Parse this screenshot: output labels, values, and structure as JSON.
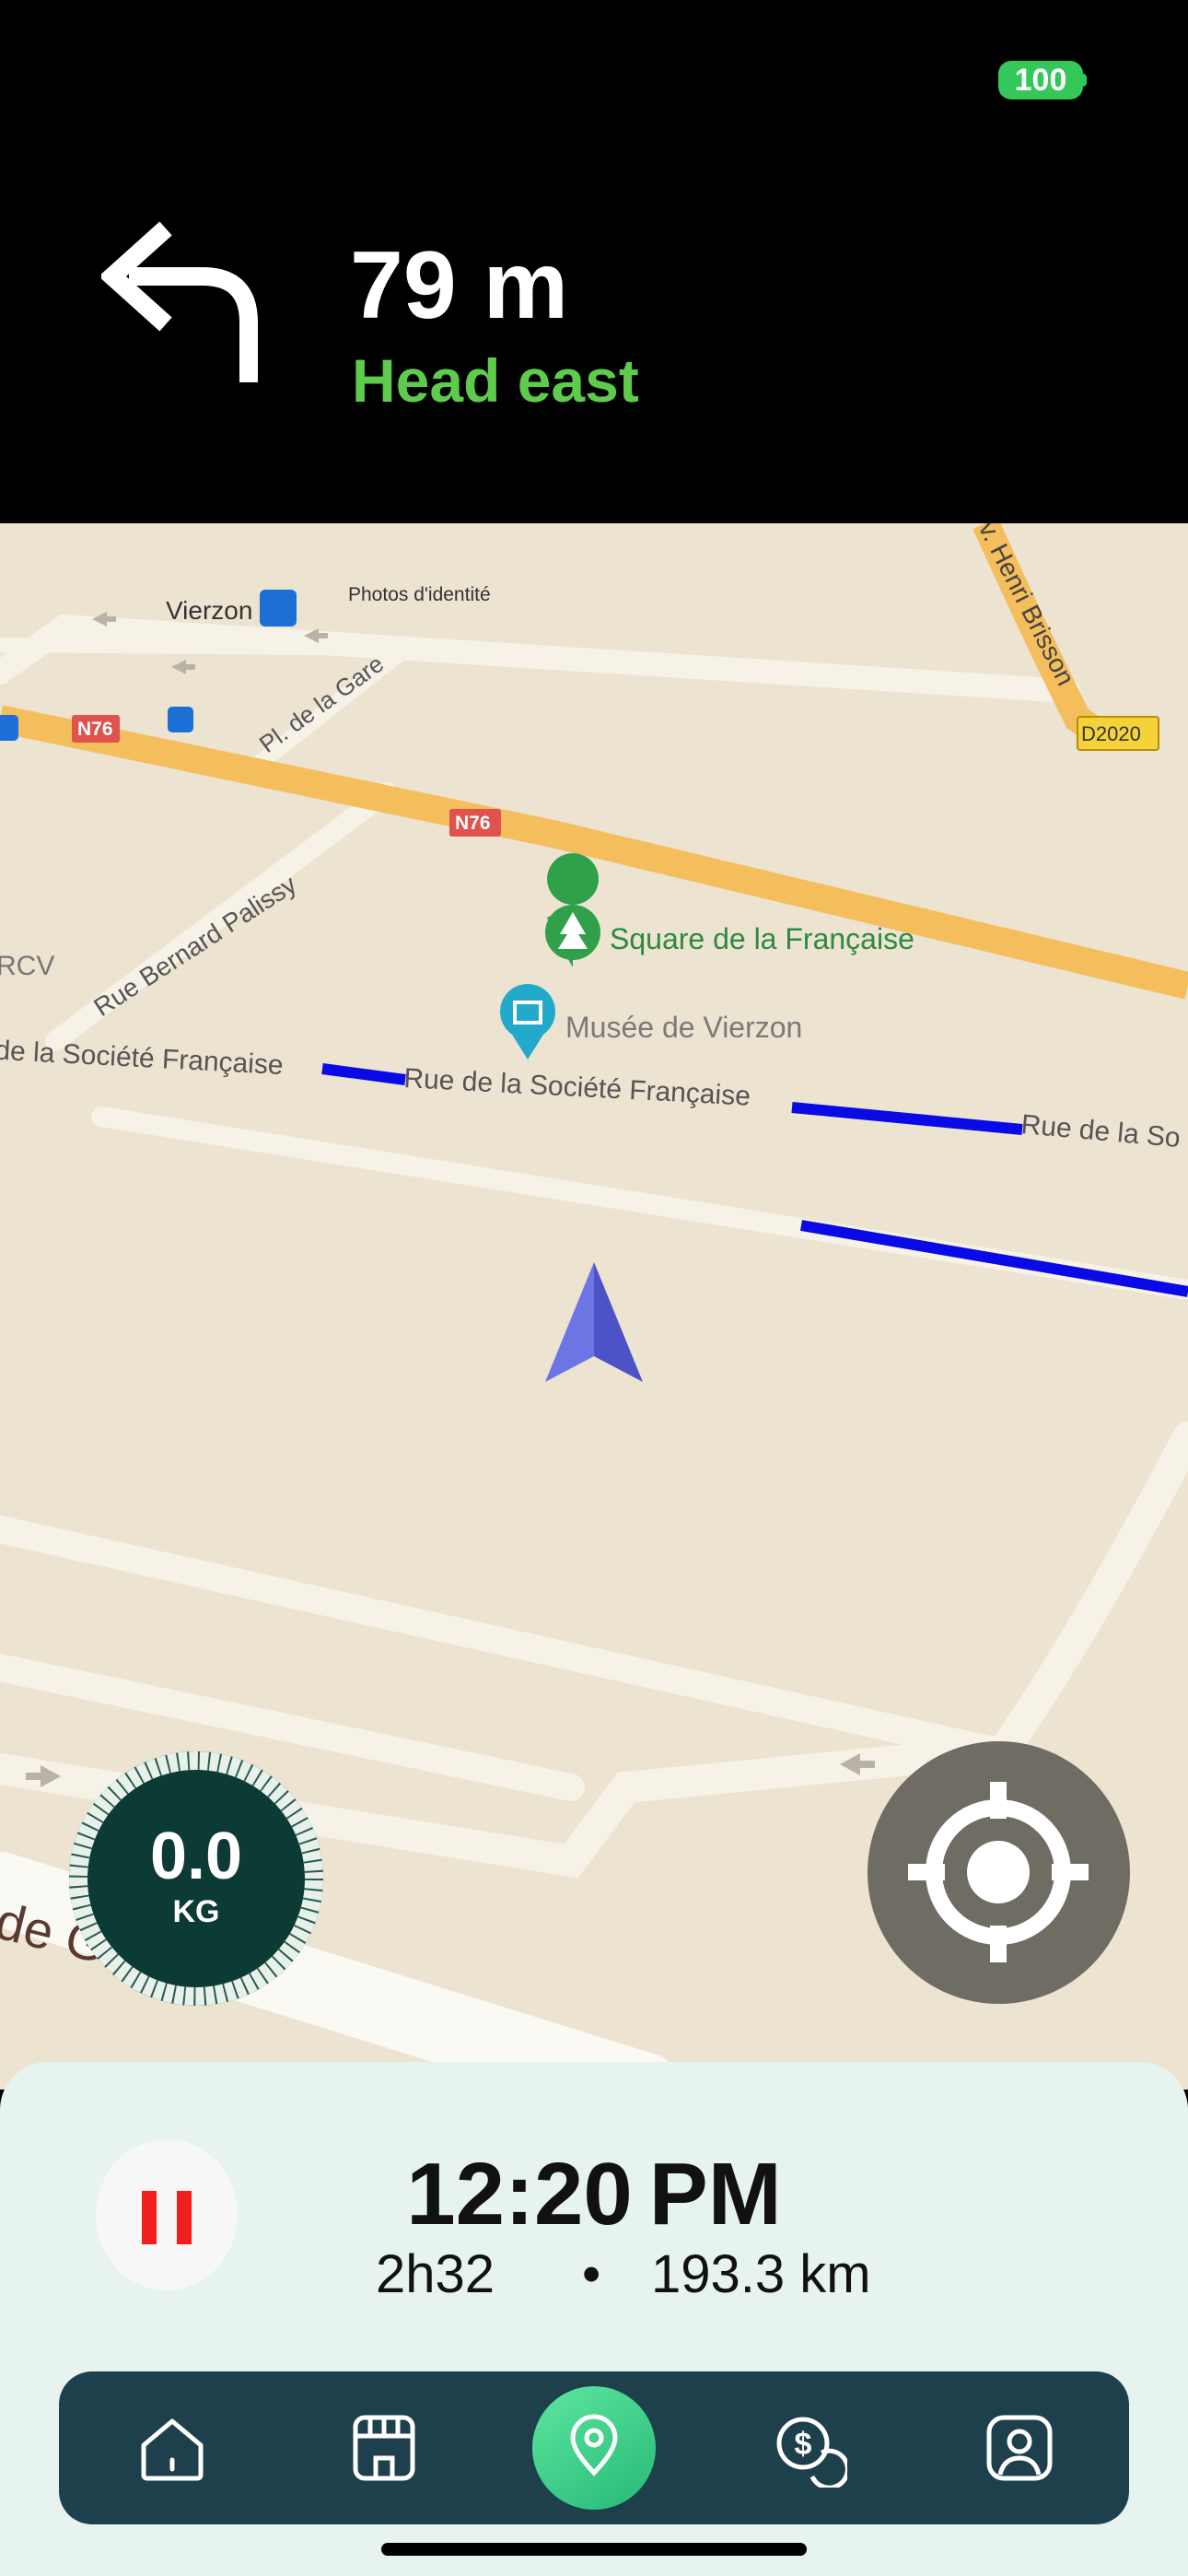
{
  "status_bar": {
    "battery": "100"
  },
  "navigation": {
    "distance": "79 m",
    "instruction": "Head east",
    "turn_icon": "turn-left-arrow-icon"
  },
  "map": {
    "labels": {
      "vierzon": "Vierzon",
      "photos": "Photos d'identité",
      "pl_gare": "Pl. de la Gare",
      "n76_a": "N76",
      "n76_b": "N76",
      "henri_brisson": "v. Henri Brisson",
      "d2020": "D2020",
      "rue_bernard_palissy": "Rue Bernard Palissy",
      "rcv": "RCV",
      "square": "Square de la Française",
      "musee": "Musée de Vierzon",
      "rue_societe_1": "de la Société Française",
      "rue_societe_2": "Rue de la Société Française",
      "rue_societe_3": "Rue de la So",
      "de_g": "de G"
    },
    "route_color": "#0a0ae6",
    "position_arrow_color": "#5b63d6"
  },
  "weight_widget": {
    "value": "0.0",
    "unit": "KG"
  },
  "trip": {
    "eta": "12:20",
    "eta_period": "PM",
    "duration": "2h32",
    "separator": "•",
    "distance": "193.3 km"
  },
  "tab_bar": {
    "items": [
      "home-icon",
      "store-icon",
      "location-pin-icon",
      "dollar-coin-icon",
      "profile-icon"
    ],
    "active": "location-pin-icon",
    "active_color": "#3ccf86"
  }
}
